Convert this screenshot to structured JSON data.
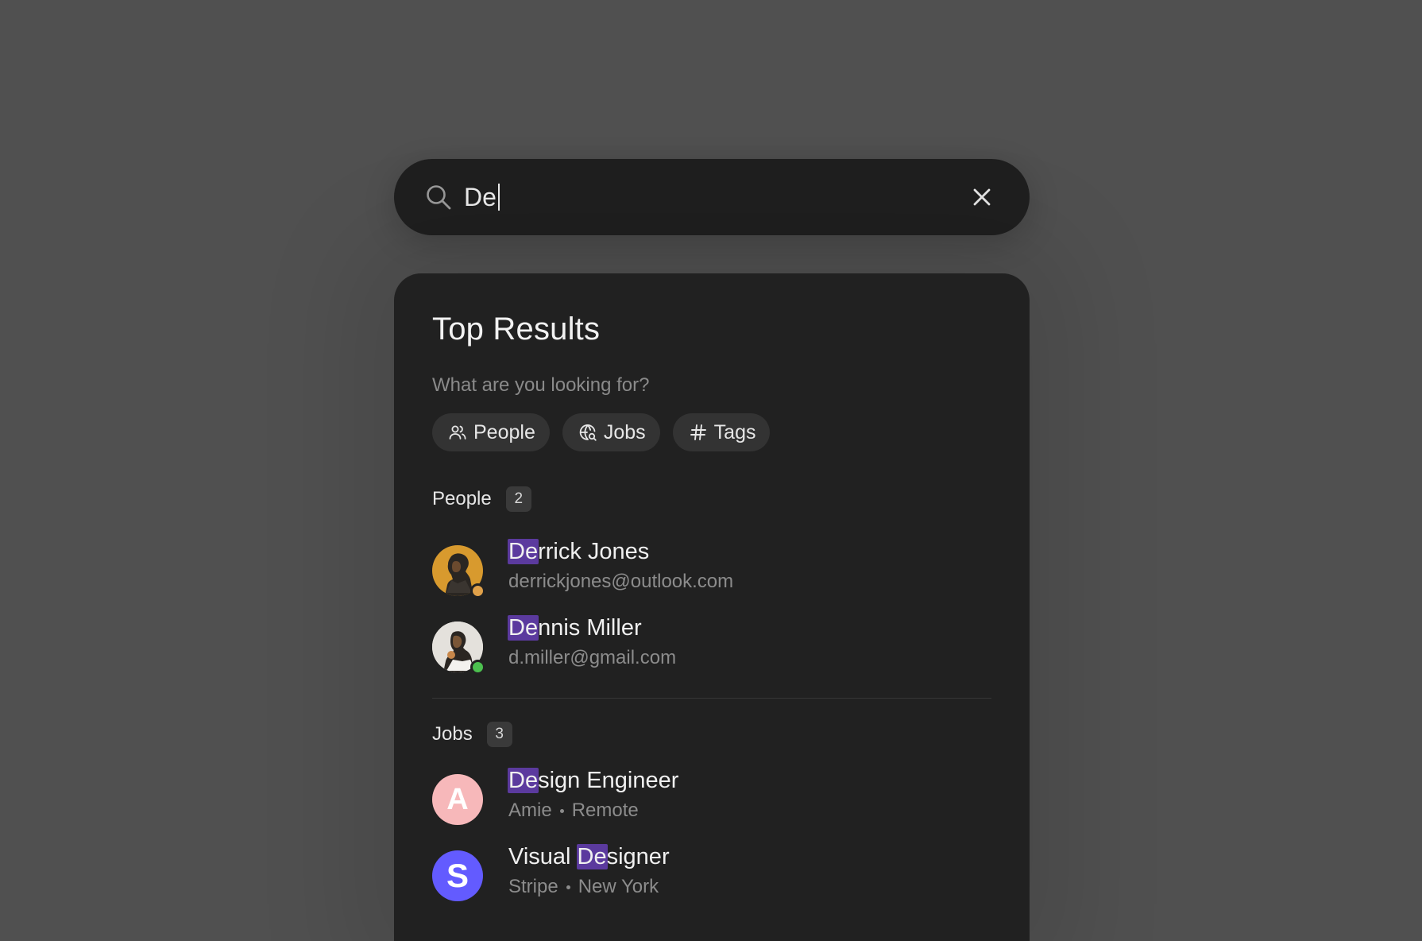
{
  "search": {
    "query": "De",
    "icon": "search-icon",
    "clear_icon": "close-icon"
  },
  "panel": {
    "title": "Top Results",
    "subtitle": "What are you looking for?",
    "filters": [
      {
        "label": "People",
        "icon": "people-icon"
      },
      {
        "label": "Jobs",
        "icon": "globe-search-icon"
      },
      {
        "label": "Tags",
        "icon": "hash-icon"
      }
    ]
  },
  "people": {
    "label": "People",
    "count": "2",
    "items": [
      {
        "highlight": "De",
        "rest": "rrick Jones",
        "email": "derrickjones@outlook.com",
        "status_color": "#e0a14a",
        "avatar_bg": "#d89a2e"
      },
      {
        "highlight": "De",
        "rest": "nnis Miller",
        "email": "d.miller@gmail.com",
        "status_color": "#4cc04f",
        "avatar_bg": "#d8d4ce"
      }
    ]
  },
  "jobs": {
    "label": "Jobs",
    "count": "3",
    "items": [
      {
        "prefix": "",
        "highlight": "De",
        "rest": "sign Engineer",
        "company": "Amie",
        "location": "Remote",
        "logo_letter": "A",
        "logo_bg": "#f7b8ba",
        "logo_fg": "#ffffff"
      },
      {
        "prefix": "Visual ",
        "highlight": "De",
        "rest": "signer",
        "company": "Stripe",
        "location": "New York",
        "logo_letter": "S",
        "logo_bg": "#635bff",
        "logo_fg": "#ffffff"
      }
    ]
  },
  "colors": {
    "background": "#505050",
    "surface": "#212121",
    "highlight": "#5b3a9e"
  }
}
